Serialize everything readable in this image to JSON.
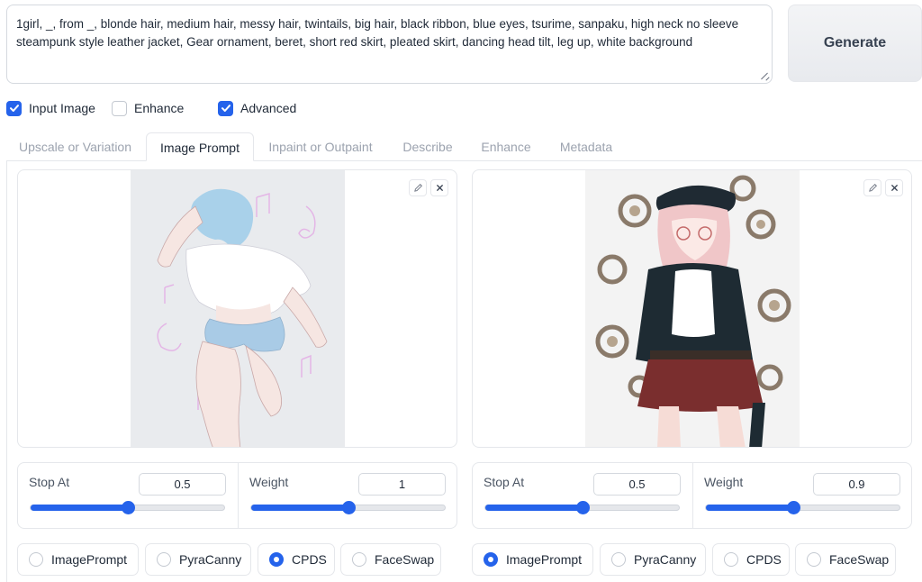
{
  "prompt": {
    "text": "1girl, _, from _, blonde hair, medium hair, messy hair, twintails, big hair, black ribbon, blue eyes, tsurime, sanpaku,  high neck no sleeve steampunk style leather jacket, Gear ornament, beret, short red skirt, pleated skirt, dancing head tilt, leg up, white background"
  },
  "generate_label": "Generate",
  "options": [
    {
      "label": "Input Image",
      "checked": true
    },
    {
      "label": "Enhance",
      "checked": false
    },
    {
      "label": "Advanced",
      "checked": true
    }
  ],
  "tabs": [
    {
      "label": "Upscale or Variation",
      "active": false
    },
    {
      "label": "Image Prompt",
      "active": true
    },
    {
      "label": "Inpaint or Outpaint",
      "active": false
    },
    {
      "label": "Describe",
      "active": false
    },
    {
      "label": "Enhance",
      "active": false
    },
    {
      "label": "Metadata",
      "active": false
    }
  ],
  "panels": [
    {
      "image_icons": [
        "pencil-icon",
        "close-icon"
      ],
      "stop_at": {
        "label": "Stop At",
        "value": "0.5",
        "fraction": 0.5
      },
      "weight": {
        "label": "Weight",
        "value": "1",
        "fraction": 0.5
      },
      "types": [
        {
          "label": "ImagePrompt",
          "selected": false
        },
        {
          "label": "PyraCanny",
          "selected": false
        },
        {
          "label": "CPDS",
          "selected": true
        },
        {
          "label": "FaceSwap",
          "selected": false
        }
      ]
    },
    {
      "image_icons": [
        "pencil-icon",
        "close-icon"
      ],
      "stop_at": {
        "label": "Stop At",
        "value": "0.5",
        "fraction": 0.5
      },
      "weight": {
        "label": "Weight",
        "value": "0.9",
        "fraction": 0.45
      },
      "types": [
        {
          "label": "ImagePrompt",
          "selected": true
        },
        {
          "label": "PyraCanny",
          "selected": false
        },
        {
          "label": "CPDS",
          "selected": false
        },
        {
          "label": "FaceSwap",
          "selected": false
        }
      ]
    }
  ],
  "colors": {
    "accent": "#2563eb",
    "border": "#e5e7eb",
    "muted_tab": "#9ca3af"
  }
}
